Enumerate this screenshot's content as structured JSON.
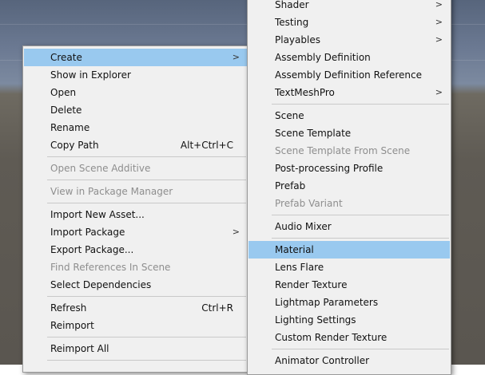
{
  "main_menu": {
    "items": [
      {
        "label": "Create",
        "has_submenu": true,
        "highlighted": true
      },
      {
        "label": "Show in Explorer"
      },
      {
        "label": "Open"
      },
      {
        "label": "Delete"
      },
      {
        "label": "Rename"
      },
      {
        "label": "Copy Path",
        "shortcut": "Alt+Ctrl+C"
      },
      {
        "label": "Open Scene Additive",
        "disabled": true
      },
      {
        "label": "View in Package Manager",
        "disabled": true
      },
      {
        "label": "Import New Asset..."
      },
      {
        "label": "Import Package",
        "has_submenu": true
      },
      {
        "label": "Export Package..."
      },
      {
        "label": "Find References In Scene",
        "disabled": true
      },
      {
        "label": "Select Dependencies"
      },
      {
        "label": "Refresh",
        "shortcut": "Ctrl+R"
      },
      {
        "label": "Reimport"
      },
      {
        "label": "Reimport All"
      }
    ]
  },
  "sub_menu": {
    "items": [
      {
        "label": "Shader",
        "has_submenu": true
      },
      {
        "label": "Testing",
        "has_submenu": true
      },
      {
        "label": "Playables",
        "has_submenu": true
      },
      {
        "label": "Assembly Definition"
      },
      {
        "label": "Assembly Definition Reference"
      },
      {
        "label": "TextMeshPro",
        "has_submenu": true
      },
      {
        "label": "Scene"
      },
      {
        "label": "Scene Template"
      },
      {
        "label": "Scene Template From Scene",
        "disabled": true
      },
      {
        "label": "Post-processing Profile"
      },
      {
        "label": "Prefab"
      },
      {
        "label": "Prefab Variant",
        "disabled": true
      },
      {
        "label": "Audio Mixer"
      },
      {
        "label": "Material",
        "highlighted": true
      },
      {
        "label": "Lens Flare"
      },
      {
        "label": "Render Texture"
      },
      {
        "label": "Lightmap Parameters"
      },
      {
        "label": "Lighting Settings"
      },
      {
        "label": "Custom Render Texture"
      },
      {
        "label": "Animator Controller"
      }
    ]
  },
  "glyphs": {
    "submenu_arrow": ">"
  },
  "colors": {
    "highlight": "#99c9ef",
    "menu_bg": "#f0f0f0",
    "disabled_text": "#8e8e8e"
  }
}
